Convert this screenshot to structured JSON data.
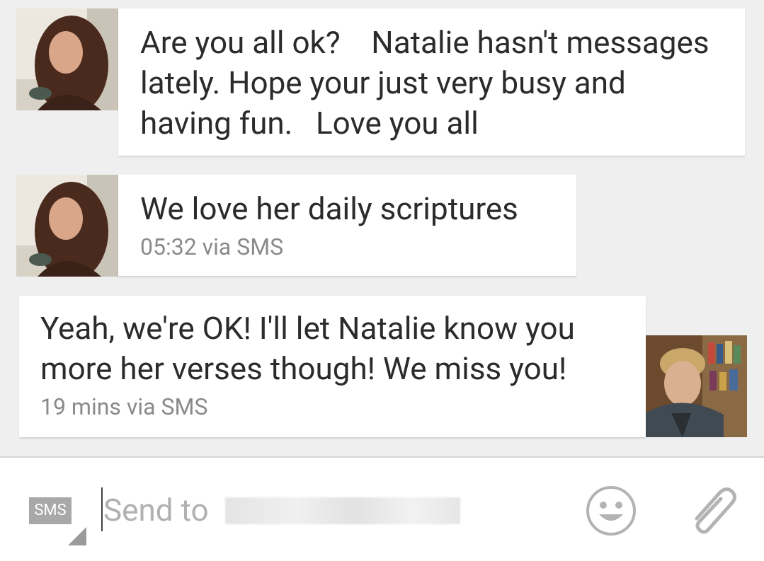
{
  "messages": [
    {
      "direction": "incoming",
      "text": "Are you all ok?    Natalie hasn't messages lately. Hope your just very busy and having fun.   Love you all",
      "meta": ""
    },
    {
      "direction": "incoming",
      "text": "We love her daily scriptures",
      "meta": "05:32 via SMS"
    },
    {
      "direction": "outgoing",
      "text": "Yeah, we're OK! I'll let Natalie know you more her verses though! We miss you!",
      "meta": "19 mins via SMS"
    }
  ],
  "composer": {
    "sms_badge": "SMS",
    "placeholder": "Send to",
    "icons": [
      "emoji-icon",
      "attachment-icon"
    ]
  },
  "colors": {
    "background": "#efefef",
    "bubble": "#ffffff",
    "text": "#2b2b2b",
    "meta_text": "#8a8a8a",
    "placeholder": "#b0b0b0",
    "icon": "#b3b3b3"
  }
}
